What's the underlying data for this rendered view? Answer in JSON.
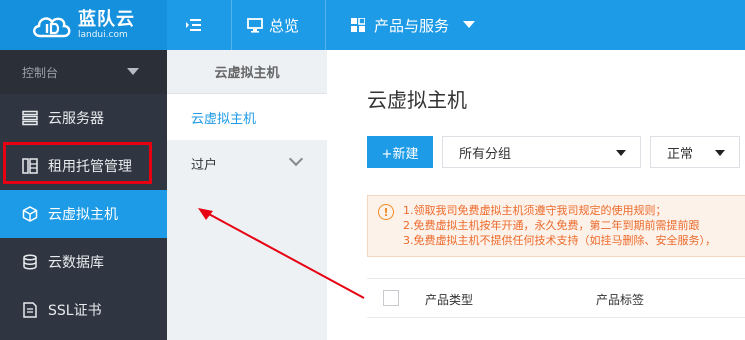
{
  "brand": {
    "name": "蓝队云",
    "domain": "landui.com",
    "color": "#1e9be6"
  },
  "topbar": {
    "overview_label": "总览",
    "products_label": "产品与服务",
    "icons": [
      "menu-fold-icon",
      "monitor-icon",
      "grid-icon",
      "caret-down-icon"
    ]
  },
  "sidebar": {
    "header": "控制台",
    "items": [
      {
        "label": "云服务器",
        "icon": "server-icon",
        "active": false
      },
      {
        "label": "租用托管管理",
        "icon": "rack-icon",
        "active": false
      },
      {
        "label": "云虚拟主机",
        "icon": "cube-icon",
        "active": true
      },
      {
        "label": "云数据库",
        "icon": "database-icon",
        "active": false
      },
      {
        "label": "SSL证书",
        "icon": "certificate-icon",
        "active": false
      }
    ]
  },
  "subnav": {
    "title": "云虚拟主机",
    "items": [
      {
        "label": "云虚拟主机",
        "active": true
      },
      {
        "label": "过户",
        "active": false
      }
    ]
  },
  "main": {
    "title": "云虚拟主机",
    "new_button": "+新建",
    "group_select": "所有分组",
    "status_select": "正常",
    "notice": [
      "1.领取我司免费虚拟主机须遵守我司规定的使用规则；",
      "2.免费虚拟主机按年开通，永久免费，第二年到期前需提前跟",
      "3.免费虚拟主机不提供任何技术支持（如挂马删除、安全服务），"
    ],
    "table_headers": [
      "产品类型",
      "产品标签"
    ]
  },
  "annotation": {
    "highlight_color": "#e60012"
  }
}
